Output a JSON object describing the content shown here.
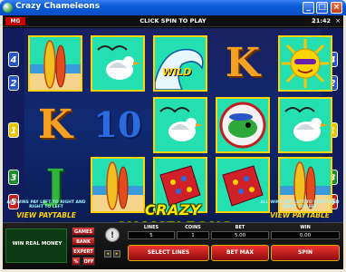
{
  "window": {
    "title": "Crazy Chameleons",
    "buttons": {
      "minimize": "_",
      "maximize": "□",
      "close": "×"
    }
  },
  "topbar": {
    "logo": "MG",
    "message": "CLICK SPIN TO PLAY",
    "clock": "21:42",
    "close_glyph": "×"
  },
  "paylines": {
    "left": [
      {
        "n": "4",
        "color": "#2a55c8"
      },
      {
        "n": "2",
        "color": "#2a55c8"
      },
      {
        "n": "1",
        "color": "#e7c400"
      },
      {
        "n": "3",
        "color": "#1d8c2a"
      },
      {
        "n": "5",
        "color": "#c02020"
      }
    ],
    "right": [
      {
        "n": "4",
        "color": "#2a55c8"
      },
      {
        "n": "2",
        "color": "#2a55c8"
      },
      {
        "n": "1",
        "color": "#e7c400"
      },
      {
        "n": "3",
        "color": "#1d8c2a"
      },
      {
        "n": "5",
        "color": "#c02020"
      }
    ]
  },
  "reels": [
    [
      "surfboard",
      "K",
      "J"
    ],
    [
      "seagull",
      "10",
      "surfboard"
    ],
    [
      "wild-wave",
      "seagull",
      "beach-towel"
    ],
    [
      "K",
      "chameleon",
      "beach-towel"
    ],
    [
      "sun",
      "seagull",
      "surfboard"
    ]
  ],
  "symbols": {
    "K": {
      "text": "K",
      "color": "#f6a021"
    },
    "J": {
      "text": "J",
      "color": "#2fb53a"
    },
    "10": {
      "text": "10",
      "color": "#2a6be0"
    },
    "wild": "WILD"
  },
  "brand": {
    "game_title": "CRAZY CHAMELEONS",
    "left_note": "ALL WINS PAY LEFT TO RIGHT AND RIGHT TO LEFT",
    "right_note": "ALL WINS PAY LEFT TO RIGHT AND RIGHT TO LEFT",
    "paytable_label": "VIEW PAYTABLE"
  },
  "panel": {
    "real_money_label": "WIN REAL MONEY",
    "games_label": "GAMES",
    "bank_label": "BANK",
    "expert_label": "EXPERT",
    "off_label": "OFF",
    "percent_label": "%",
    "help_label": "!",
    "lines_label": "LINES",
    "lines_value": "5",
    "coins_label": "COINS",
    "coins_value": "1",
    "bet_label": "BET",
    "bet_value": "5.00",
    "win_label": "WIN",
    "win_value": "0.00",
    "select_lines": "SELECT LINES",
    "bet_max": "BET MAX",
    "spin": "SPIN"
  }
}
